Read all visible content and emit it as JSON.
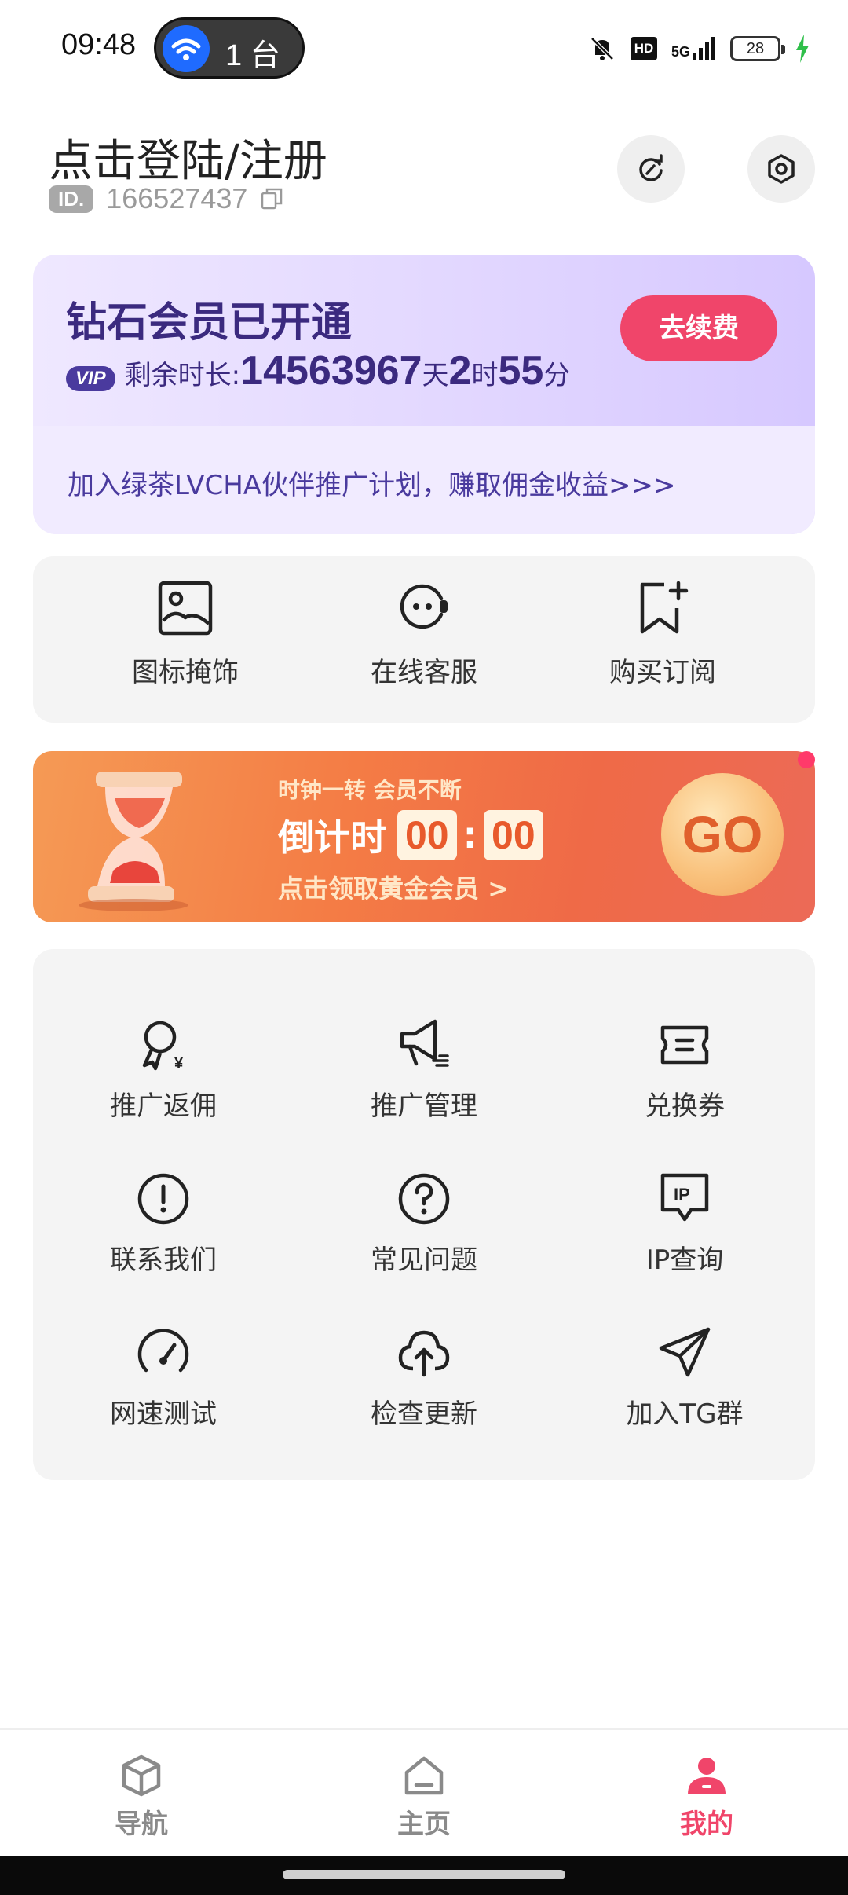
{
  "status_bar": {
    "time": "09:48",
    "devices_count": "1 台",
    "network": "5G",
    "hd_label": "HD",
    "battery": "28"
  },
  "header": {
    "login_label": "点击登陆/注册",
    "id_badge": "ID.",
    "user_id": "166527437"
  },
  "vip": {
    "title": "钻石会员已开通",
    "badge": "VIP",
    "remaining_label": "剩余时长:",
    "days": "14563967",
    "days_unit": "天",
    "hours": "2",
    "hours_unit": "时",
    "minutes": "55",
    "minutes_unit": "分",
    "renew_label": "去续费",
    "promo_text": "加入绿茶LVCHA伙伴推广计划，赚取佣金收益>>>"
  },
  "quick_actions": [
    {
      "label": "图标掩饰",
      "icon": "image-icon"
    },
    {
      "label": "在线客服",
      "icon": "headset-icon"
    },
    {
      "label": "购买订阅",
      "icon": "bookmark-plus-icon"
    }
  ],
  "banner": {
    "line1": "时钟一转 会员不断",
    "countdown_label": "倒计时",
    "minutes": "00",
    "seconds": "00",
    "line3": "点击领取黄金会员 >",
    "go_label": "GO"
  },
  "menu": [
    {
      "label": "推广返佣",
      "icon": "award-icon"
    },
    {
      "label": "推广管理",
      "icon": "megaphone-icon"
    },
    {
      "label": "兑换券",
      "icon": "ticket-icon"
    },
    {
      "label": "联系我们",
      "icon": "alert-circle-icon"
    },
    {
      "label": "常见问题",
      "icon": "help-circle-icon"
    },
    {
      "label": "IP查询",
      "icon": "ip-icon"
    },
    {
      "label": "网速测试",
      "icon": "speedometer-icon"
    },
    {
      "label": "检查更新",
      "icon": "cloud-upload-icon"
    },
    {
      "label": "加入TG群",
      "icon": "send-icon"
    }
  ],
  "bottom_nav": [
    {
      "label": "导航",
      "icon": "cube-icon"
    },
    {
      "label": "主页",
      "icon": "home-icon"
    },
    {
      "label": "我的",
      "icon": "user-icon",
      "active": true
    }
  ],
  "colors": {
    "accent": "#f0456a",
    "vip_text": "#3b2a7f",
    "card_bg": "#f4f4f4"
  }
}
